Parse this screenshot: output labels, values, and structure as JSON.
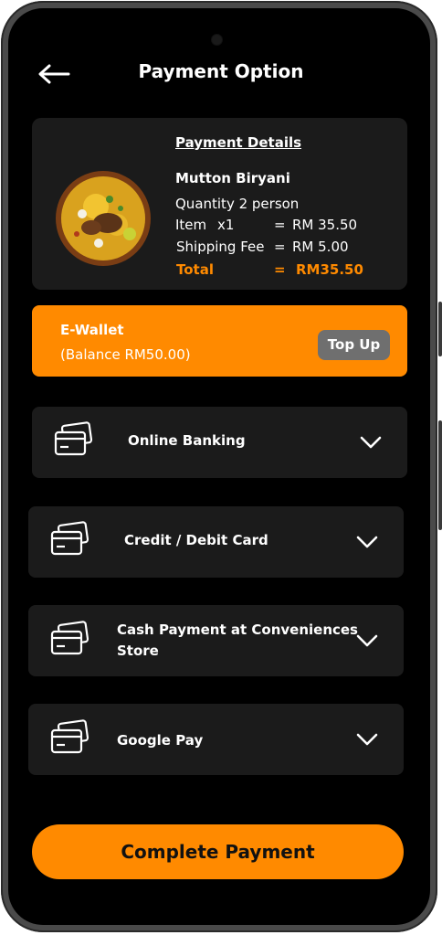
{
  "header": {
    "title": "Payment Option"
  },
  "details": {
    "heading": "Payment Details",
    "item_name": "Mutton Biryani",
    "quantity": "Quantity 2 person",
    "item_label": "Item",
    "item_qty": "x1",
    "equals": "=",
    "item_price": "RM 35.50",
    "shipping_label": "Shipping Fee",
    "shipping_price": "RM 5.00",
    "total_label": "Total",
    "total_price": "RM35.50"
  },
  "ewallet": {
    "title": "E-Wallet",
    "balance": "(Balance RM50.00)",
    "topup_label": "Top Up"
  },
  "options": [
    {
      "label": "Online Banking"
    },
    {
      "label": "Credit / Debit Card"
    },
    {
      "label_line1": "Cash Payment at Conveniences",
      "label_line2": "Store"
    },
    {
      "label": "Google Pay"
    }
  ],
  "complete_label": "Complete Payment",
  "colors": {
    "accent": "#ff8a00",
    "card": "#1b1b1b",
    "background": "#000000"
  }
}
